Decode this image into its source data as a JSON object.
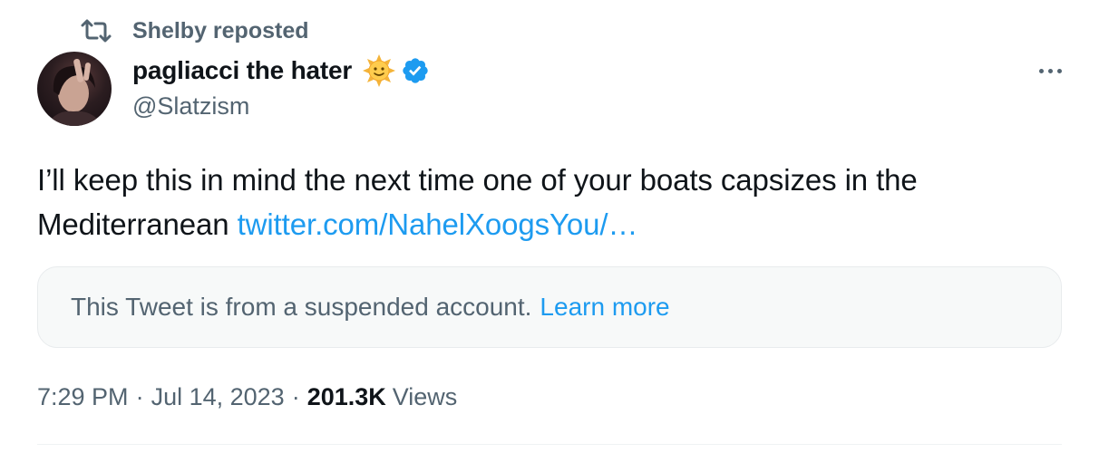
{
  "repost": {
    "text": "Shelby reposted",
    "icon": "repost-icon"
  },
  "author": {
    "display_name": "pagliacci the hater",
    "emoji": "sun-with-face",
    "verified": true,
    "verified_color": "#1d9bf0",
    "handle": "@Slatzism"
  },
  "tweet": {
    "text": "I’ll keep this in mind the next time one of your boats capsizes in the Mediterranean",
    "link": "twitter.com/NahelXoogsYou/…"
  },
  "quoted_notice": {
    "text": "This Tweet is from a suspended account.",
    "link": "Learn more"
  },
  "meta": {
    "time": "7:29 PM",
    "separator": "·",
    "date": "Jul 14, 2023",
    "views_count": "201.3K",
    "views_label": "Views"
  },
  "colors": {
    "accent": "#1d9bf0",
    "secondary_text": "#536471",
    "primary_text": "#0f1419"
  }
}
